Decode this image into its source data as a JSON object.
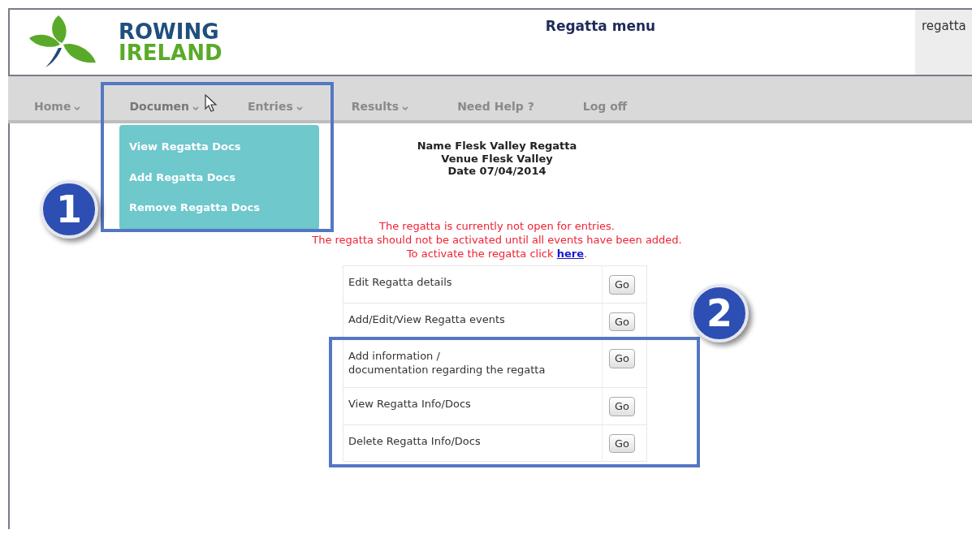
{
  "header": {
    "logo_line1": "ROWING",
    "logo_line2": "IRELAND",
    "title": "Regatta menu",
    "user_text": "regatta"
  },
  "nav": [
    {
      "label": "Home",
      "dropdown": true,
      "open": false
    },
    {
      "label": "Documen",
      "dropdown": true,
      "open": true
    },
    {
      "label": "Entries",
      "dropdown": true,
      "open": false
    },
    {
      "label": "Results",
      "dropdown": true,
      "open": false
    },
    {
      "label": "Need Help ?",
      "dropdown": false,
      "open": false
    },
    {
      "label": "Log off",
      "dropdown": false,
      "open": false
    }
  ],
  "dropdown_items": [
    "View Regatta Docs",
    "Add Regatta Docs",
    "Remove Regatta Docs"
  ],
  "regatta_info": [
    "Name Flesk Valley Regatta",
    "Venue Flesk Valley",
    "Date 07/04/2014"
  ],
  "notices": [
    "The regatta is currently not open for entries.",
    "The regatta should not be activated until all events have been added."
  ],
  "activate": {
    "text": "To activate the regatta click",
    "link": "here",
    "after": "."
  },
  "actions": [
    {
      "label": "Edit Regatta details",
      "button": "Go"
    },
    {
      "label": "Add/Edit/View Regatta events",
      "button": "Go"
    },
    {
      "label": "Add information /\ndocumentation regarding the regatta",
      "button": "Go"
    },
    {
      "label": "View Regatta Info/Docs",
      "button": "Go"
    },
    {
      "label": "Delete Regatta Info/Docs",
      "button": "Go"
    }
  ],
  "callouts": [
    "1",
    "2"
  ]
}
